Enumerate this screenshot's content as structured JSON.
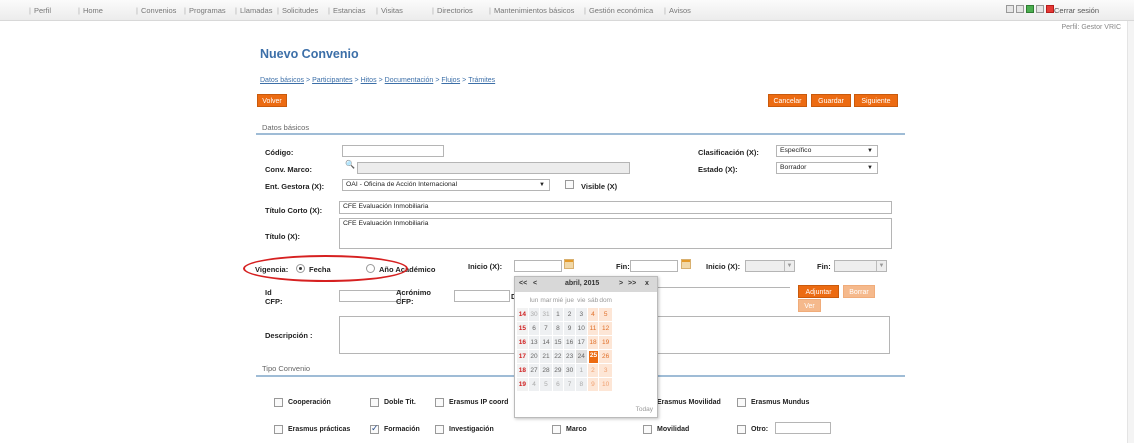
{
  "nav": {
    "items": [
      "Perfil",
      "Home",
      "Convenios",
      "Programas",
      "Llamadas",
      "Solicitudes",
      "Estancias",
      "Visitas",
      "Directorios",
      "Mantenimientos básicos",
      "Gestión económica",
      "Avisos"
    ],
    "logout": "Cerrar sesión",
    "profile": "Perfil: Gestor VRIC"
  },
  "page": {
    "title": "Nuevo Convenio",
    "breadcrumb": [
      "Datos básicos",
      "Participantes",
      "Hitos",
      "Documentación",
      "Flujos",
      "Trámites"
    ],
    "breadcrumb_sep": ">"
  },
  "buttons": {
    "back": "Volver",
    "cancel": "Cancelar",
    "save": "Guardar",
    "next": "Siguiente",
    "attach": "Adjuntar",
    "delete": "Borrar",
    "view": "Ver"
  },
  "sections": {
    "basic": "Datos básicos",
    "type": "Tipo Convenio"
  },
  "form": {
    "codigo_label": "Código:",
    "codigo_value": "",
    "marco_label": "Conv. Marco:",
    "gestora_label": "Ent. Gestora (X):",
    "gestora_value": "OAI - Oficina de Acción Internacional",
    "visible_label": "Visible (X)",
    "titulo_corto_label": "Título Corto (X):",
    "titulo_corto_value": "CFE Evaluación Inmobiliaria",
    "titulo_label": "Título (X):",
    "titulo_value": "CFE Evaluación Inmobiliaria",
    "clasificacion_label": "Clasificación (X):",
    "clasificacion_value": "Específico",
    "estado_label": "Estado (X):",
    "estado_value": "Borrador",
    "vigencia_label": "Vigencia:",
    "vig_fecha": "Fecha",
    "vig_ano": "Año Académico",
    "inicio_label": "Inicio (X):",
    "fin_label": "Fin:",
    "inicio2_label": "Inicio (X):",
    "fin2_label": "Fin:",
    "id_label": "Id",
    "cfp_label": "CFP:",
    "acronimo_label": "Acrónimo",
    "cfp2_label": "CFP:",
    "d_label": "D",
    "descripcion_label": "Descripción :"
  },
  "tipo": {
    "row1": [
      "Cooperación",
      "Doble Tit.",
      "Erasmus IP coord",
      "Erasmus Movilidad",
      "Erasmus Mundus"
    ],
    "row2": [
      "Erasmus prácticas",
      "Formación",
      "Investigación",
      "Marco",
      "Movilidad",
      "Otro:"
    ],
    "checked": "Formación"
  },
  "calendar": {
    "prev_year": "<<",
    "prev_month": "<",
    "month_label": "abril, 2015",
    "next_month": ">",
    "next_year": ">>",
    "close": "x",
    "weekdays": [
      "lun",
      "mar",
      "mié",
      "jue",
      "vie",
      "sáb",
      "dom"
    ],
    "weeks": [
      {
        "wk": "14",
        "days": [
          "30",
          "31",
          "1",
          "2",
          "3",
          "4",
          "5"
        ]
      },
      {
        "wk": "15",
        "days": [
          "6",
          "7",
          "8",
          "9",
          "10",
          "11",
          "12"
        ]
      },
      {
        "wk": "16",
        "days": [
          "13",
          "14",
          "15",
          "16",
          "17",
          "18",
          "19"
        ]
      },
      {
        "wk": "17",
        "days": [
          "20",
          "21",
          "22",
          "23",
          "24",
          "25",
          "26"
        ]
      },
      {
        "wk": "18",
        "days": [
          "27",
          "28",
          "29",
          "30",
          "1",
          "2",
          "3"
        ]
      },
      {
        "wk": "19",
        "days": [
          "4",
          "5",
          "6",
          "7",
          "8",
          "9",
          "10"
        ]
      }
    ],
    "selected_day": "25",
    "today": "Today"
  }
}
